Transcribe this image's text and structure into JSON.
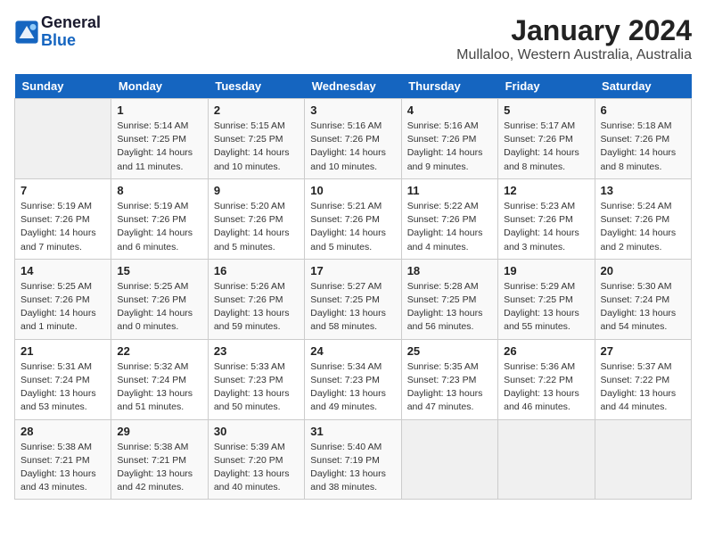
{
  "logo": {
    "line1": "General",
    "line2": "Blue"
  },
  "title": "January 2024",
  "subtitle": "Mullaloo, Western Australia, Australia",
  "weekdays": [
    "Sunday",
    "Monday",
    "Tuesday",
    "Wednesday",
    "Thursday",
    "Friday",
    "Saturday"
  ],
  "weeks": [
    [
      {
        "day": "",
        "content": ""
      },
      {
        "day": "1",
        "content": "Sunrise: 5:14 AM\nSunset: 7:25 PM\nDaylight: 14 hours\nand 11 minutes."
      },
      {
        "day": "2",
        "content": "Sunrise: 5:15 AM\nSunset: 7:25 PM\nDaylight: 14 hours\nand 10 minutes."
      },
      {
        "day": "3",
        "content": "Sunrise: 5:16 AM\nSunset: 7:26 PM\nDaylight: 14 hours\nand 10 minutes."
      },
      {
        "day": "4",
        "content": "Sunrise: 5:16 AM\nSunset: 7:26 PM\nDaylight: 14 hours\nand 9 minutes."
      },
      {
        "day": "5",
        "content": "Sunrise: 5:17 AM\nSunset: 7:26 PM\nDaylight: 14 hours\nand 8 minutes."
      },
      {
        "day": "6",
        "content": "Sunrise: 5:18 AM\nSunset: 7:26 PM\nDaylight: 14 hours\nand 8 minutes."
      }
    ],
    [
      {
        "day": "7",
        "content": "Sunrise: 5:19 AM\nSunset: 7:26 PM\nDaylight: 14 hours\nand 7 minutes."
      },
      {
        "day": "8",
        "content": "Sunrise: 5:19 AM\nSunset: 7:26 PM\nDaylight: 14 hours\nand 6 minutes."
      },
      {
        "day": "9",
        "content": "Sunrise: 5:20 AM\nSunset: 7:26 PM\nDaylight: 14 hours\nand 5 minutes."
      },
      {
        "day": "10",
        "content": "Sunrise: 5:21 AM\nSunset: 7:26 PM\nDaylight: 14 hours\nand 5 minutes."
      },
      {
        "day": "11",
        "content": "Sunrise: 5:22 AM\nSunset: 7:26 PM\nDaylight: 14 hours\nand 4 minutes."
      },
      {
        "day": "12",
        "content": "Sunrise: 5:23 AM\nSunset: 7:26 PM\nDaylight: 14 hours\nand 3 minutes."
      },
      {
        "day": "13",
        "content": "Sunrise: 5:24 AM\nSunset: 7:26 PM\nDaylight: 14 hours\nand 2 minutes."
      }
    ],
    [
      {
        "day": "14",
        "content": "Sunrise: 5:25 AM\nSunset: 7:26 PM\nDaylight: 14 hours\nand 1 minute."
      },
      {
        "day": "15",
        "content": "Sunrise: 5:25 AM\nSunset: 7:26 PM\nDaylight: 14 hours\nand 0 minutes."
      },
      {
        "day": "16",
        "content": "Sunrise: 5:26 AM\nSunset: 7:26 PM\nDaylight: 13 hours\nand 59 minutes."
      },
      {
        "day": "17",
        "content": "Sunrise: 5:27 AM\nSunset: 7:25 PM\nDaylight: 13 hours\nand 58 minutes."
      },
      {
        "day": "18",
        "content": "Sunrise: 5:28 AM\nSunset: 7:25 PM\nDaylight: 13 hours\nand 56 minutes."
      },
      {
        "day": "19",
        "content": "Sunrise: 5:29 AM\nSunset: 7:25 PM\nDaylight: 13 hours\nand 55 minutes."
      },
      {
        "day": "20",
        "content": "Sunrise: 5:30 AM\nSunset: 7:24 PM\nDaylight: 13 hours\nand 54 minutes."
      }
    ],
    [
      {
        "day": "21",
        "content": "Sunrise: 5:31 AM\nSunset: 7:24 PM\nDaylight: 13 hours\nand 53 minutes."
      },
      {
        "day": "22",
        "content": "Sunrise: 5:32 AM\nSunset: 7:24 PM\nDaylight: 13 hours\nand 51 minutes."
      },
      {
        "day": "23",
        "content": "Sunrise: 5:33 AM\nSunset: 7:23 PM\nDaylight: 13 hours\nand 50 minutes."
      },
      {
        "day": "24",
        "content": "Sunrise: 5:34 AM\nSunset: 7:23 PM\nDaylight: 13 hours\nand 49 minutes."
      },
      {
        "day": "25",
        "content": "Sunrise: 5:35 AM\nSunset: 7:23 PM\nDaylight: 13 hours\nand 47 minutes."
      },
      {
        "day": "26",
        "content": "Sunrise: 5:36 AM\nSunset: 7:22 PM\nDaylight: 13 hours\nand 46 minutes."
      },
      {
        "day": "27",
        "content": "Sunrise: 5:37 AM\nSunset: 7:22 PM\nDaylight: 13 hours\nand 44 minutes."
      }
    ],
    [
      {
        "day": "28",
        "content": "Sunrise: 5:38 AM\nSunset: 7:21 PM\nDaylight: 13 hours\nand 43 minutes."
      },
      {
        "day": "29",
        "content": "Sunrise: 5:38 AM\nSunset: 7:21 PM\nDaylight: 13 hours\nand 42 minutes."
      },
      {
        "day": "30",
        "content": "Sunrise: 5:39 AM\nSunset: 7:20 PM\nDaylight: 13 hours\nand 40 minutes."
      },
      {
        "day": "31",
        "content": "Sunrise: 5:40 AM\nSunset: 7:19 PM\nDaylight: 13 hours\nand 38 minutes."
      },
      {
        "day": "",
        "content": ""
      },
      {
        "day": "",
        "content": ""
      },
      {
        "day": "",
        "content": ""
      }
    ]
  ]
}
